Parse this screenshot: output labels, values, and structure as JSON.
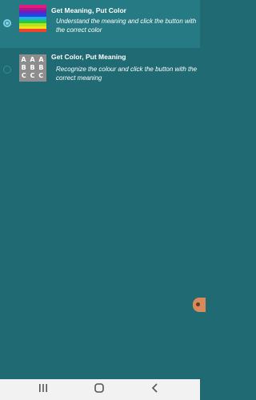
{
  "options": [
    {
      "title": "Get Meaning, Put Color",
      "description": "Understand the meaning and click the button with the correct color",
      "selected": true,
      "thumbnail": "rainbow-stripes-icon"
    },
    {
      "title": "Get Color, Put Meaning",
      "description": "Recognize the colour and click the button with the correct meaning",
      "selected": false,
      "thumbnail": "letter-grid-icon",
      "thumbnail_rows": [
        "A A A",
        "B B B",
        "C C C"
      ]
    }
  ],
  "colors": {
    "background": "#1f6a73",
    "selected_row": "#267a83",
    "radio_accent": "#7fd0e8",
    "navbar": "#f2f2f2"
  },
  "navbar": {
    "icons": [
      "recent-apps-icon",
      "home-icon",
      "back-icon"
    ]
  }
}
